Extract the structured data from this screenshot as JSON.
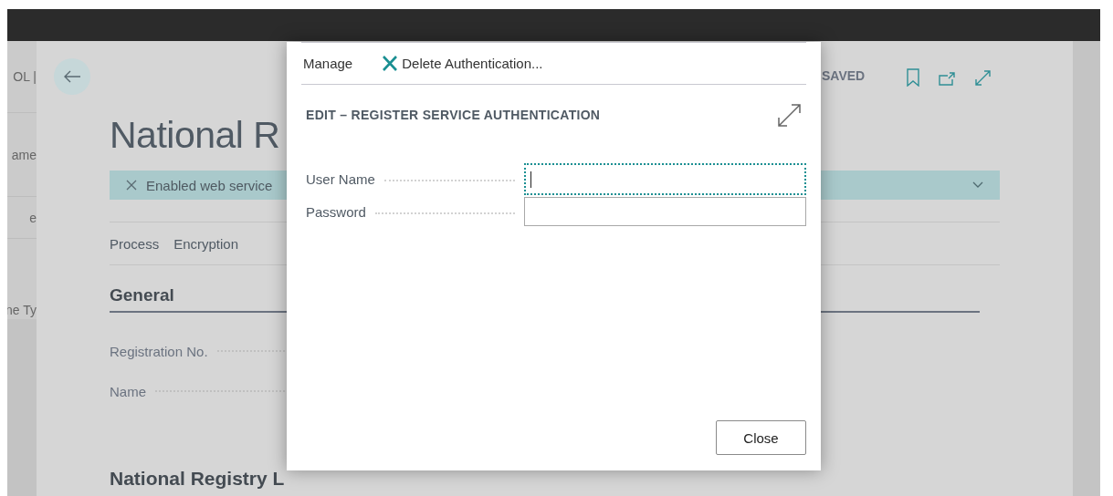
{
  "sidebar": {
    "items": [
      {
        "label": "OL |"
      },
      {
        "label": "ame"
      },
      {
        "label": "e"
      },
      {
        "label": "ne Ty"
      }
    ]
  },
  "page": {
    "status": "SAVED",
    "title": "National R",
    "notification": {
      "text": "Enabled web service"
    },
    "actions": [
      "Process",
      "Encryption"
    ],
    "section": {
      "title": "General",
      "fields": [
        {
          "label": "Registration No."
        },
        {
          "label": "Name"
        }
      ]
    },
    "next_section": "National Registry L"
  },
  "dialog": {
    "actions": [
      {
        "kind": "menu",
        "label": "Manage"
      },
      {
        "kind": "delete",
        "label": "Delete Authentication..."
      }
    ],
    "title": "EDIT – REGISTER SERVICE AUTHENTICATION",
    "fields": [
      {
        "label": "User Name",
        "focused": true
      },
      {
        "label": "Password",
        "focused": false
      }
    ],
    "buttons": [
      "Close"
    ]
  }
}
